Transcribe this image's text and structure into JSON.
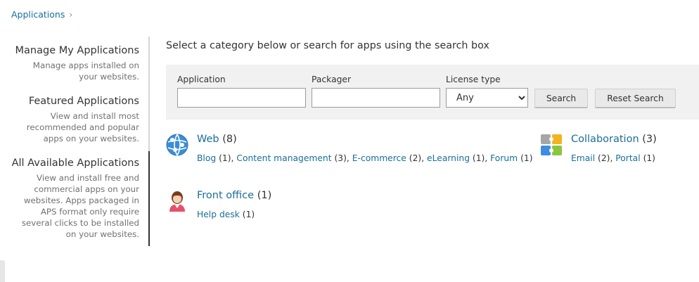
{
  "breadcrumb": {
    "label": "Applications",
    "chevron": "›"
  },
  "sidebar": {
    "items": [
      {
        "title": "Manage My Applications",
        "desc": [
          "Manage apps installed on",
          "your websites."
        ]
      },
      {
        "title": "Featured Applications",
        "desc": [
          "View and install most",
          "recommended and popular",
          "apps on your websites."
        ]
      },
      {
        "title": "All Available Applications",
        "desc": [
          "View and install free and",
          "commercial apps on your",
          "websites. Apps packaged in",
          "APS format only require",
          "several clicks to be installed",
          "on your websites."
        ]
      }
    ]
  },
  "intro": "Select a category below or search for apps using the search box",
  "search": {
    "application_label": "Application",
    "application_value": "",
    "packager_label": "Packager",
    "packager_value": "",
    "license_label": "License type",
    "license_selected": "Any",
    "search_button": "Search",
    "reset_button": "Reset Search"
  },
  "categories": {
    "web": {
      "name": "Web",
      "count": "(8)",
      "icon": "globe-icon",
      "subs": [
        {
          "name": "Blog",
          "count": "(1)"
        },
        {
          "name": "Content management",
          "count": "(3)"
        },
        {
          "name": "E-commerce",
          "count": "(2)"
        },
        {
          "name": "eLearning",
          "count": "(1)"
        },
        {
          "name": "Forum",
          "count": "(1)"
        }
      ]
    },
    "collaboration": {
      "name": "Collaboration",
      "count": "(3)",
      "icon": "collaboration-icon",
      "subs": [
        {
          "name": "Email",
          "count": "(2)"
        },
        {
          "name": "Portal",
          "count": "(1)"
        }
      ]
    },
    "front_office": {
      "name": "Front office",
      "count": "(1)",
      "icon": "person-icon",
      "subs": [
        {
          "name": "Help desk",
          "count": "(1)"
        }
      ]
    }
  },
  "colors": {
    "link": "#1a6e98",
    "panel": "#f1f1f1",
    "globe": "#3a8ed6"
  }
}
